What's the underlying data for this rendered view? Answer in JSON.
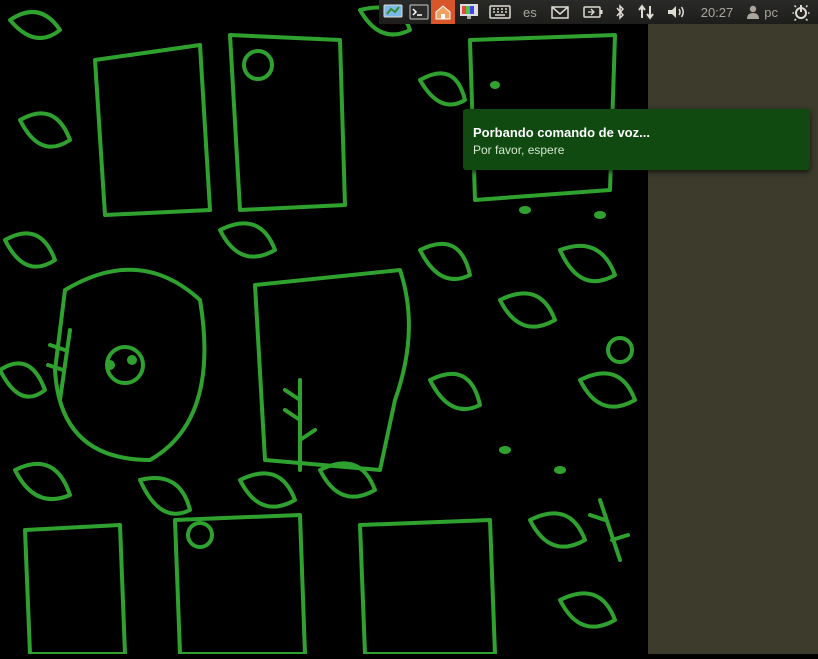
{
  "panel": {
    "keyboard_layout": "es",
    "clock": "20:27",
    "user": "pc"
  },
  "notification": {
    "title": "Porbando comando de voz...",
    "body": "Por favor, espere"
  },
  "colors": {
    "wallpaper_bg": "#000000",
    "wallpaper_line": "#2fa12f",
    "side_panel": "#3c3b2c",
    "notification_bg": "#104a10"
  }
}
